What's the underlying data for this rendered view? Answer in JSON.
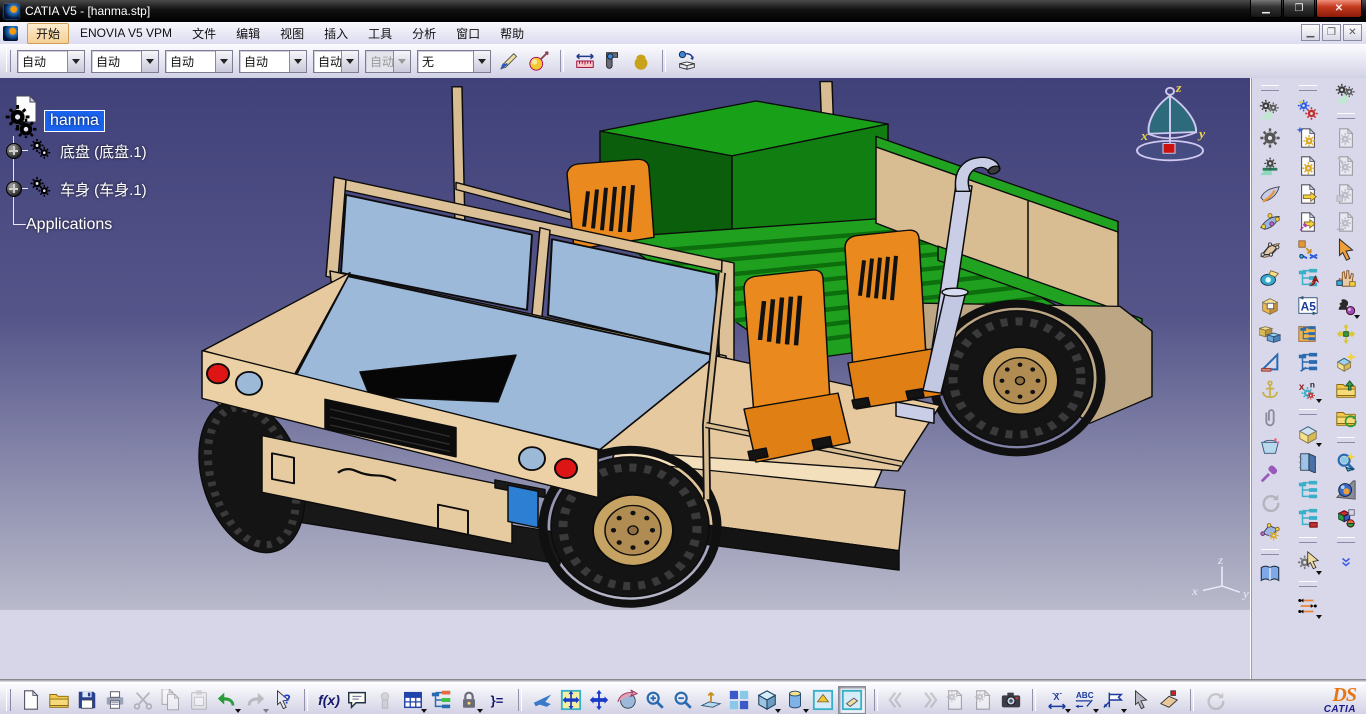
{
  "window": {
    "title": "CATIA V5 - [hanma.stp]"
  },
  "menu": {
    "items": [
      "开始",
      "ENOVIA V5 VPM",
      "文件",
      "编辑",
      "视图",
      "插入",
      "工具",
      "分析",
      "窗口",
      "帮助"
    ],
    "active_item": "开始",
    "window_controls": [
      "minimize",
      "restore",
      "close"
    ]
  },
  "toolbar_top": {
    "combos": [
      "自动",
      "自动",
      "自动",
      "自动",
      "自动",
      "自动",
      "无"
    ],
    "disabled_combo_index": 5,
    "icons": [
      "paintbrush-icon",
      "magic-wand-sphere-icon",
      "ruler-measure-icon",
      "caliper-measure-icon",
      "kettlebell-inertia-icon",
      "sphere-arrow-box-icon"
    ]
  },
  "tree": {
    "root_label": "hanma",
    "root_selected": true,
    "nodes": [
      "底盘 (底盘.1)",
      "车身 (车身.1)"
    ],
    "applications_label": "Applications"
  },
  "viewport": {
    "background_top": "#41417a",
    "background_bottom": "#b9bacb",
    "compass_axes": {
      "x": "x",
      "y": "y",
      "z": "z"
    },
    "triad_axes": {
      "x": "x",
      "y": "y",
      "z": "z"
    },
    "model": {
      "description": "hanma military utility vehicle 3D model",
      "colors": {
        "body_tan": "#ecd0a6",
        "body_khaki": "#bca684",
        "bed_green": "#1fa11f",
        "bed_dark_green": "#0b5e0b",
        "seat_orange": "#ea8a1e",
        "glass_blue": "#9cb9da",
        "tire_black": "#141414",
        "hub_tan": "#c6a263",
        "exhaust_silver": "#c9cde6",
        "light_red": "#dd1515",
        "light_blue": "#9db9d8",
        "winch_blue": "#2d7fd3"
      }
    }
  },
  "toolbar_right": {
    "column1": [
      "gears-green-arrow-icon",
      "gear-icon",
      "gear-workbench-icon",
      "surface-book-icon",
      "surface-star-icon",
      "net-tree-icon",
      "pen-camera-icon",
      "yellow-box-icon",
      "blue-boxes-icon",
      "set-square-icon",
      "anchor-icon",
      "paperclip-icon",
      "basin-icon",
      "screwdriver-icon",
      "circular-arrows-icon",
      "constellation-star-icon",
      "book-icon"
    ],
    "column2": [
      "sparkle-gears-icon",
      "doc-gear-sparkle-icon",
      "doc-gear-icon",
      "doc-arrow-icon",
      "doc-wrench-icon",
      "box-arrow-icon",
      "tree-red-arrow-icon",
      "a5-numbering-icon",
      "tree-orange-icon",
      "tree-blue-icon",
      "xn-gear-icon",
      "box-stack-icon",
      "door-window-icon",
      "tree-cyan-icon",
      "tree-cyan-red-icon",
      "gear-cursor-icon",
      "orange-arrows-icon"
    ],
    "column3": [
      "gears-green-arrow-2-icon",
      "doc-gear-gray-1-icon",
      "doc-gear-gray-2-icon",
      "doc-gear-gray-3-icon",
      "doc-gear-gray-4-icon",
      "orange-cursor-icon",
      "hand-boxes-icon",
      "knight-sphere-icon",
      "four-arrows-icon",
      "box-star-icon",
      "folder-up-icon",
      "folder-recycle-icon",
      "magnifier-star-icon",
      "render-sphere-icon",
      "colored-boxes-icon",
      "double-chevron-down-icon"
    ]
  },
  "toolbar_bottom": {
    "icons": [
      "new-document-icon",
      "open-folder-icon",
      "save-floppy-icon",
      "print-icon",
      "cut-scissors-icon",
      "copy-icon",
      "paste-clipboard-icon",
      "undo-arrow-icon",
      "redo-arrow-icon",
      "help-cursor-icon",
      "fx-formula-icon",
      "speech-bubble-icon",
      "gray-badge-icon",
      "design-table-icon",
      "colored-tree-icon",
      "lock-icon",
      "braces-equal-icon",
      "fly-plane-icon",
      "fit-all-icon",
      "pan-cross-icon",
      "rotate-sphere-icon",
      "zoom-in-magnifier-icon",
      "zoom-out-magnifier-icon",
      "normal-view-icon",
      "multi-view-icon",
      "iso-cube-icon",
      "render-cylinder-icon",
      "hide-show-box-icon",
      "swap-space-box-icon",
      "skip-back-icon",
      "skip-forward-icon",
      "doc-gear-gray-a-icon",
      "doc-gear-gray-b-icon",
      "camera-capture-icon",
      "measure-xy-icon",
      "abc-text-icon",
      "flag-annotation-icon",
      "pointer-3d-icon",
      "eraser-red-icon",
      "refresh-icon"
    ],
    "fx_label": "f(x)",
    "abc_label": "ABC",
    "braces_label": "}=",
    "logo": {
      "ds": "DS",
      "catia": "CATIA"
    }
  }
}
